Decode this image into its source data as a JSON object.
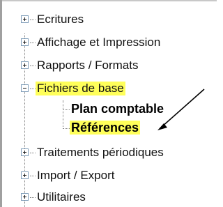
{
  "tree": {
    "items": [
      {
        "label": "Ecritures",
        "state": "collapsed"
      },
      {
        "label": "Affichage et Impression",
        "state": "collapsed"
      },
      {
        "label": "Rapports / Formats",
        "state": "collapsed"
      },
      {
        "label": "Fichiers de base",
        "state": "expanded",
        "highlighted": true,
        "children": [
          {
            "label": "Plan comptable"
          },
          {
            "label": "Références",
            "highlighted": true
          }
        ]
      },
      {
        "label": "Traitements périodiques",
        "state": "collapsed"
      },
      {
        "label": "Import / Export",
        "state": "collapsed"
      },
      {
        "label": "Utilitaires",
        "state": "collapsed"
      }
    ]
  },
  "colors": {
    "highlight": "#ffff5a",
    "arrow": "#000000"
  }
}
